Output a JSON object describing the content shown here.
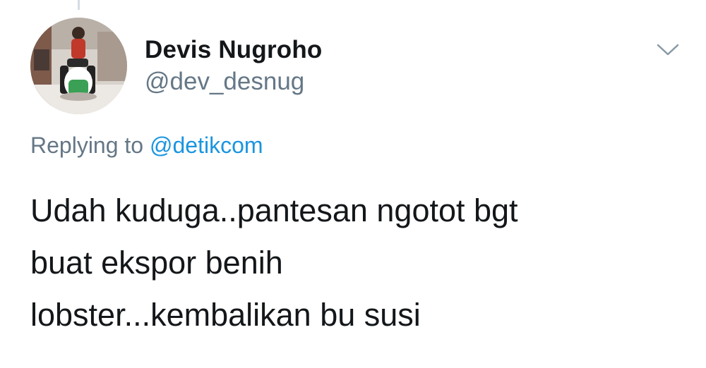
{
  "tweet": {
    "author": {
      "display_name": "Devis Nugroho",
      "handle": "@dev_desnug"
    },
    "reply": {
      "prefix": "Replying to",
      "to_handle": "@detikcom"
    },
    "text_lines": [
      "Udah kuduga..pantesan ngotot bgt",
      "buat ekspor benih",
      "lobster...kembalikan bu susi"
    ],
    "menu_icon": "chevron-down-icon"
  },
  "colors": {
    "text_primary": "#14171a",
    "text_secondary": "#657786",
    "link": "#1b95e0",
    "icon": "#8899a6"
  }
}
